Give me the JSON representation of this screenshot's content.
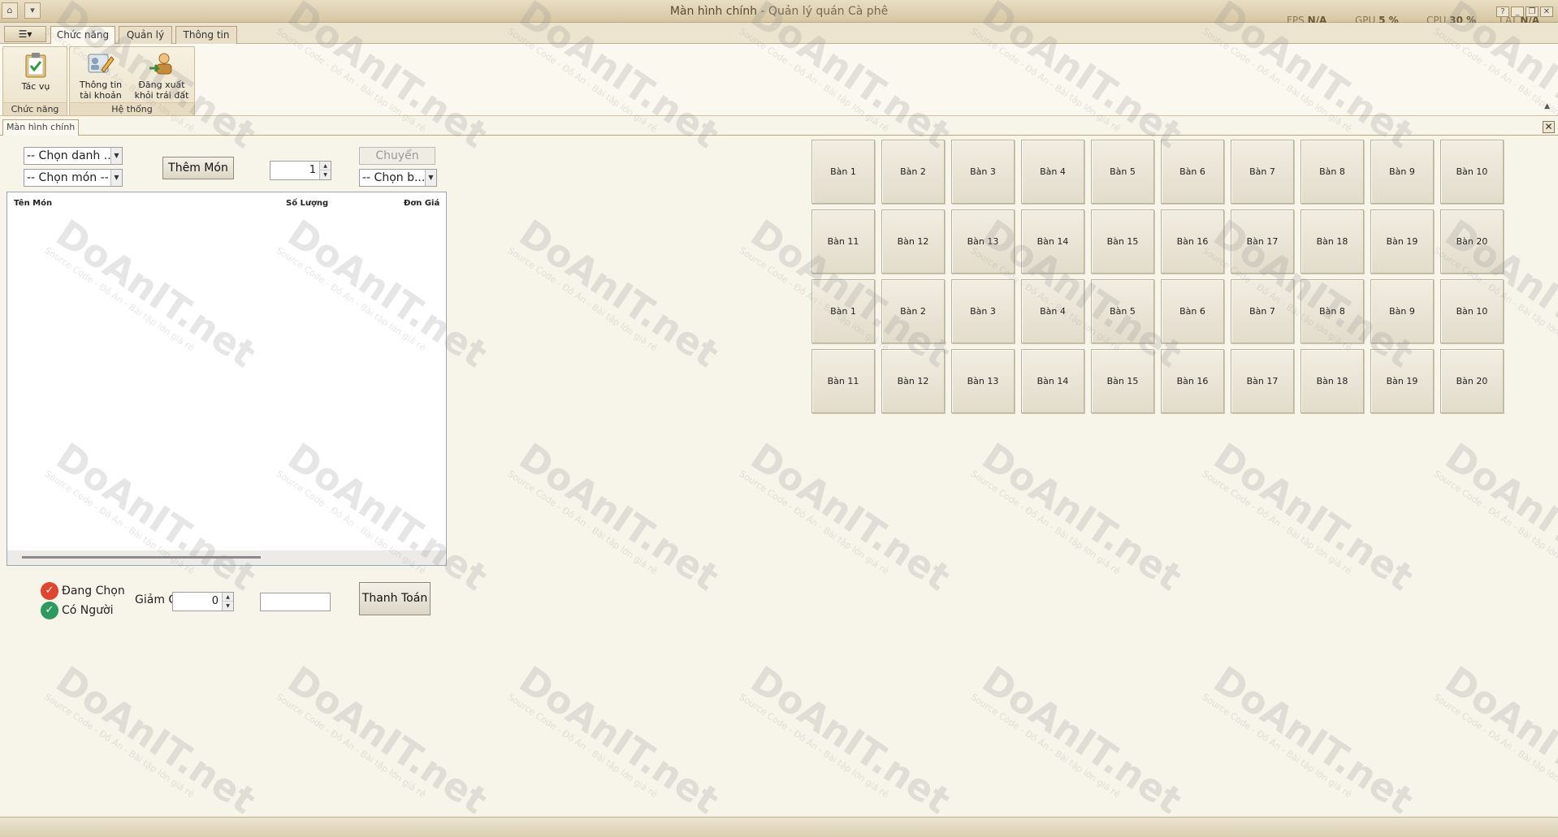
{
  "window": {
    "title_main": "Màn hình chính",
    "title_separator": " - ",
    "title_app": "Quản lý quán Cà phê",
    "perf": [
      {
        "label": "FPS",
        "value": "N/A"
      },
      {
        "label": "GPU",
        "value": "5 %"
      },
      {
        "label": "CPU",
        "value": "30 %"
      },
      {
        "label": "LAT",
        "value": "N/A"
      }
    ]
  },
  "ribbon": {
    "tabs": [
      {
        "label": "Chức năng",
        "active": true
      },
      {
        "label": "Quản lý",
        "active": false
      },
      {
        "label": "Thông tin",
        "active": false
      }
    ],
    "groups": [
      {
        "label": "Chức năng",
        "buttons": [
          {
            "label": "Tác vụ",
            "icon": "clipboard-check-icon"
          }
        ]
      },
      {
        "label": "Hệ thống",
        "buttons": [
          {
            "label_line1": "Thông tin",
            "label_line2": "tài khoản",
            "icon": "edit-profile-icon"
          },
          {
            "label_line1": "Đăng xuất",
            "label_line2": "khỏi trái đất",
            "icon": "logout-user-icon"
          }
        ]
      }
    ]
  },
  "document_tab": "Màn hình chính",
  "order_panel": {
    "category_combo": "-- Chọn danh ...",
    "item_combo": "-- Chọn món --",
    "add_button": "Thêm Món",
    "quantity": "1",
    "transfer_button": "Chuyển",
    "table_combo": "-- Chọn b...",
    "grid_columns": [
      "Tên Món",
      "Số Lượng",
      "Đơn Giá"
    ]
  },
  "legend": [
    {
      "label": "Đang Chọn",
      "color": "#e0452e"
    },
    {
      "label": "Có Người",
      "color": "#2f9a5f"
    }
  ],
  "payment": {
    "discount_label": "Giảm Giá",
    "discount_value": "0",
    "total_value": "",
    "pay_button": "Thanh Toán"
  },
  "tables": [
    "Bàn 1",
    "Bàn 2",
    "Bàn 3",
    "Bàn 4",
    "Bàn 5",
    "Bàn 6",
    "Bàn 7",
    "Bàn 8",
    "Bàn 9",
    "Bàn 10",
    "Bàn 11",
    "Bàn 12",
    "Bàn 13",
    "Bàn 14",
    "Bàn 15",
    "Bàn 16",
    "Bàn 17",
    "Bàn 18",
    "Bàn 19",
    "Bàn 20",
    "Bàn 1",
    "Bàn 2",
    "Bàn 3",
    "Bàn 4",
    "Bàn 5",
    "Bàn 6",
    "Bàn 7",
    "Bàn 8",
    "Bàn 9",
    "Bàn 10",
    "Bàn 11",
    "Bàn 12",
    "Bàn 13",
    "Bàn 14",
    "Bàn 15",
    "Bàn 16",
    "Bàn 17",
    "Bàn 18",
    "Bàn 19",
    "Bàn 20"
  ],
  "watermark": {
    "text": "DoAnIT.net",
    "subtext": "Source Code - Đồ Án - Bài tập lớn giá rẻ"
  }
}
